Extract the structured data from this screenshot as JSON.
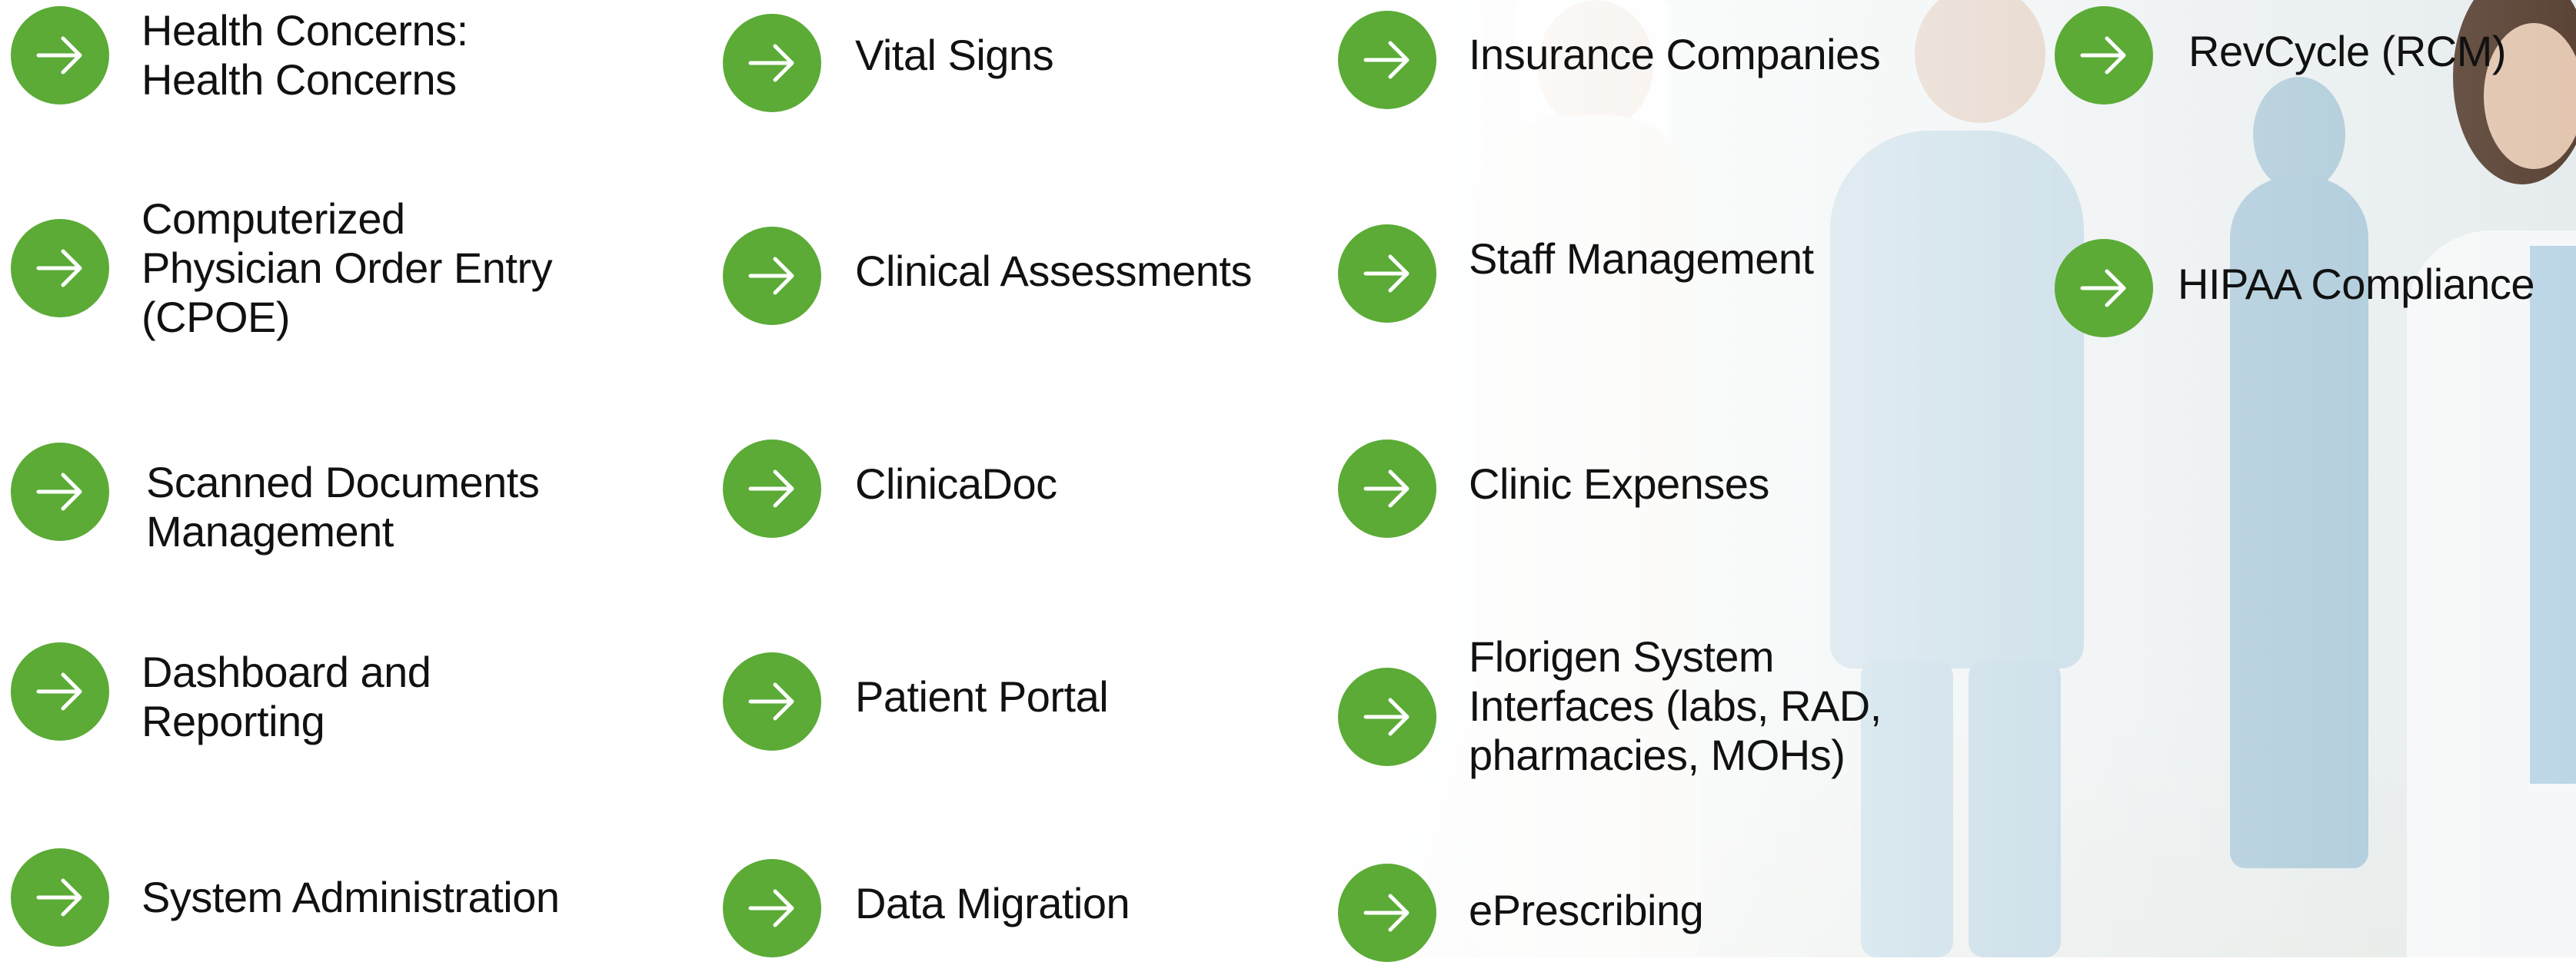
{
  "colors": {
    "accent_green": "#5bab36",
    "text": "#111111",
    "background": "#ffffff"
  },
  "icons": {
    "feature_button": "arrow-right-icon"
  },
  "features": [
    {
      "label": "Health Concerns:\nHealth Concerns"
    },
    {
      "label": "Computerized\nPhysician Order Entry\n(CPOE)"
    },
    {
      "label": "Scanned Documents\nManagement"
    },
    {
      "label": "Dashboard and\nReporting"
    },
    {
      "label": "System Administration"
    },
    {
      "label": "Vital Signs"
    },
    {
      "label": "Clinical Assessments"
    },
    {
      "label": "ClinicaDoc"
    },
    {
      "label": "Patient Portal"
    },
    {
      "label": "Data Migration"
    },
    {
      "label": "Insurance Companies"
    },
    {
      "label": "Staff Management"
    },
    {
      "label": "Clinic Expenses"
    },
    {
      "label": "Florigen System\nInterfaces (labs, RAD,\npharmacies, MOHs)"
    },
    {
      "label": "ePrescribing"
    },
    {
      "label": "RevCycle (RCM)"
    },
    {
      "label": "HIPAA Compliance"
    }
  ]
}
